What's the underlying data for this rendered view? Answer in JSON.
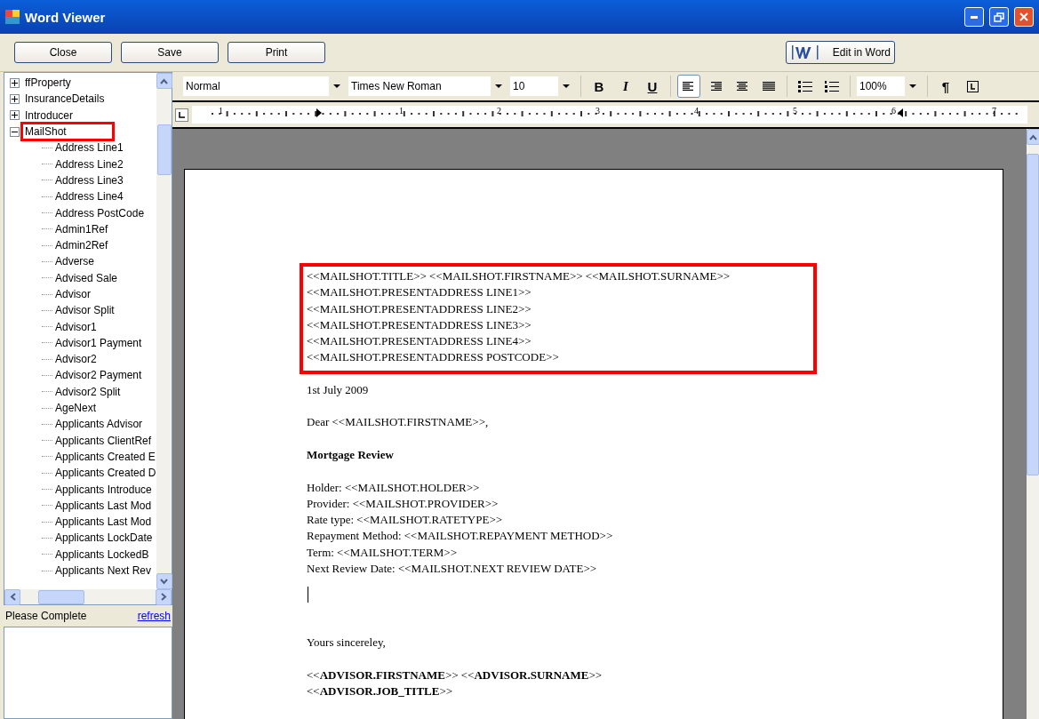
{
  "window": {
    "title": "Word Viewer"
  },
  "buttons": [
    {
      "label": "Close"
    },
    {
      "label": "Save"
    },
    {
      "label": "Print"
    }
  ],
  "edit_button": {
    "label": "Edit in Word"
  },
  "tree": [
    {
      "label": "ffProperty",
      "expanded": false,
      "highlighted": false
    },
    {
      "label": "InsuranceDetails",
      "expanded": false,
      "highlighted": false
    },
    {
      "label": "Introducer",
      "expanded": false,
      "highlighted": false
    },
    {
      "label": "MailShot",
      "expanded": true,
      "highlighted": true,
      "children": [
        {
          "label": "Address Line1"
        },
        {
          "label": "Address Line2"
        },
        {
          "label": "Address Line3"
        },
        {
          "label": "Address Line4"
        },
        {
          "label": "Address PostCode"
        },
        {
          "label": "Admin1Ref"
        },
        {
          "label": "Admin2Ref"
        },
        {
          "label": "Adverse"
        },
        {
          "label": "Advised Sale"
        },
        {
          "label": "Advisor"
        },
        {
          "label": "Advisor Split"
        },
        {
          "label": "Advisor1"
        },
        {
          "label": "Advisor1 Payment"
        },
        {
          "label": "Advisor2"
        },
        {
          "label": "Advisor2 Payment"
        },
        {
          "label": "Advisor2 Split"
        },
        {
          "label": "AgeNext"
        },
        {
          "label": "Applicants Advisor"
        },
        {
          "label": "Applicants ClientRef"
        },
        {
          "label": "Applicants Created E"
        },
        {
          "label": "Applicants Created D"
        },
        {
          "label": "Applicants Introduce"
        },
        {
          "label": "Applicants Last Mod"
        },
        {
          "label": "Applicants Last Mod"
        },
        {
          "label": "Applicants LockDate"
        },
        {
          "label": "Applicants LockedB"
        },
        {
          "label": "Applicants Next Rev"
        }
      ]
    }
  ],
  "notes": {
    "label": "Please Complete",
    "link": "refresh"
  },
  "toolbar": {
    "style": "Normal",
    "font": "Times New Roman",
    "size": "10",
    "zoom": "100%",
    "bold": "B",
    "italic": "I",
    "underline": "U",
    "pilcrow": "¶",
    "alignments": [
      {
        "kind": "left",
        "selected": true
      },
      {
        "kind": "right",
        "selected": false
      },
      {
        "kind": "center",
        "selected": false
      },
      {
        "kind": "justify",
        "selected": false
      }
    ]
  },
  "ruler": {
    "numbers": [
      "1",
      "1",
      "2",
      "3",
      "4",
      "5",
      "6",
      "7"
    ]
  },
  "document": {
    "address_block": {
      "highlighted": true,
      "lines": [
        "<<MAILSHOT.TITLE>> <<MAILSHOT.FIRSTNAME>> <<MAILSHOT.SURNAME>>",
        "<<MAILSHOT.PRESENTADDRESS LINE1>>",
        "<<MAILSHOT.PRESENTADDRESS LINE2>>",
        "<<MAILSHOT.PRESENTADDRESS LINE3>>",
        "<<MAILSHOT.PRESENTADDRESS LINE4>>",
        "<<MAILSHOT.PRESENTADDRESS POSTCODE>>"
      ]
    },
    "date": "1st July 2009",
    "greeting": "Dear <<MAILSHOT.FIRSTNAME>>,",
    "heading": "Mortgage Review",
    "details": [
      "Holder: <<MAILSHOT.HOLDER>>",
      "Provider: <<MAILSHOT.PROVIDER>>",
      "Rate type: <<MAILSHOT.RATETYPE>>",
      "Repayment Method: <<MAILSHOT.REPAYMENT METHOD>>",
      "Term: <<MAILSHOT.TERM>>",
      "Next Review Date: <<MAILSHOT.NEXT REVIEW DATE>>"
    ],
    "closing": "Yours sincereley,",
    "signature": [
      "<<**ADVISOR.FIRSTNAME**>> <<**ADVISOR.SURNAME**>>",
      "<<**ADVISOR.JOB_TITLE**>>"
    ]
  }
}
